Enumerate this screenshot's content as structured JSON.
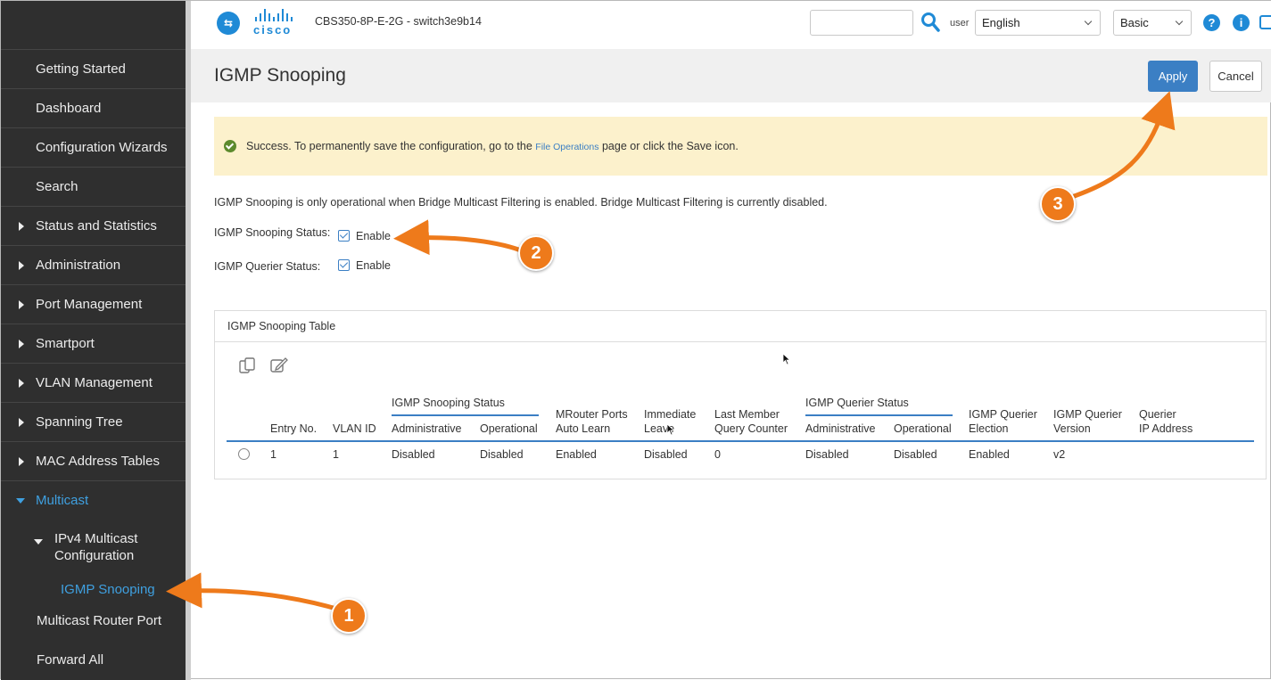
{
  "header": {
    "device_name": "CBS350-8P-E-2G - switch3e9b14",
    "brand": "cisco",
    "user_label": "user",
    "language": "English",
    "mode": "Basic",
    "search_value": ""
  },
  "sidebar": {
    "items": [
      {
        "label": "Getting Started"
      },
      {
        "label": "Dashboard"
      },
      {
        "label": "Configuration Wizards"
      },
      {
        "label": "Search"
      },
      {
        "label": "Status and Statistics"
      },
      {
        "label": "Administration"
      },
      {
        "label": "Port Management"
      },
      {
        "label": "Smartport"
      },
      {
        "label": "VLAN Management"
      },
      {
        "label": "Spanning Tree"
      },
      {
        "label": "MAC Address Tables"
      },
      {
        "label": "Multicast"
      }
    ],
    "sub_group": "IPv4 Multicast Configuration",
    "sub_group_line1": "IPv4 Multicast",
    "sub_group_line2": "Configuration",
    "sub_items": [
      {
        "label": "IGMP Snooping"
      },
      {
        "label": "Multicast Router Port"
      },
      {
        "label": "Forward All"
      }
    ]
  },
  "page": {
    "title": "IGMP Snooping",
    "apply_label": "Apply",
    "cancel_label": "Cancel",
    "banner_prefix": "Success. To permanently save the configuration, go to the ",
    "banner_link": "File Operations",
    "banner_suffix": " page or click the Save icon.",
    "note": "IGMP Snooping is only operational when Bridge Multicast Filtering is enabled. Bridge Multicast Filtering is currently disabled.",
    "snooping_status_label": "IGMP Snooping Status:",
    "snooping_status_value": "Enable",
    "querier_status_label": "IGMP Querier Status:",
    "querier_status_value": "Enable"
  },
  "table": {
    "title": "IGMP Snooping Table",
    "group_snooping": "IGMP Snooping Status",
    "group_querier": "IGMP Querier Status",
    "columns": {
      "entry_no": "Entry No.",
      "vlan_id": "VLAN ID",
      "snoop_admin": "Administrative",
      "snoop_oper": "Operational",
      "mrouter_1": "MRouter Ports",
      "mrouter_2": "Auto Learn",
      "immediate_1": "Immediate",
      "immediate_2": "Leave",
      "lastmember_1": "Last Member",
      "lastmember_2": "Query Counter",
      "querier_admin": "Administrative",
      "querier_oper": "Operational",
      "election_1": "IGMP Querier",
      "election_2": "Election",
      "version_1": "IGMP Querier",
      "version_2": "Version",
      "ip_1": "Querier",
      "ip_2": "IP Address"
    },
    "rows": [
      {
        "entry_no": "1",
        "vlan_id": "1",
        "snoop_admin": "Disabled",
        "snoop_oper": "Disabled",
        "mrouter": "Enabled",
        "immediate": "Disabled",
        "lastmember": "0",
        "querier_admin": "Disabled",
        "querier_oper": "Disabled",
        "election": "Enabled",
        "version": "v2",
        "ip": ""
      }
    ]
  },
  "callouts": [
    "1",
    "2",
    "3"
  ],
  "colors": {
    "accent": "#3b7fc4",
    "sidebar_bg": "#2f2f2f",
    "callout": "#ee7a1b",
    "banner_bg": "#fcf1cc"
  }
}
